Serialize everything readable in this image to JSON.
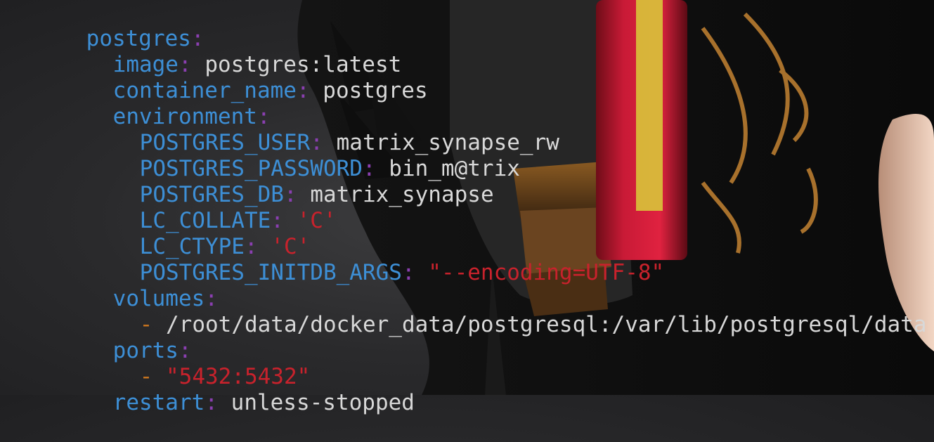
{
  "colors": {
    "key": "#3d8fd6",
    "colon": "#8a3fb0",
    "plain_value": "#d8d8d8",
    "string_value": "#c8222c",
    "list_dash": "#c6741f"
  },
  "yaml": {
    "service_key": "postgres",
    "image_key": "image",
    "image_value": "postgres:latest",
    "container_name_key": "container_name",
    "container_name_value": "postgres",
    "environment_key": "environment",
    "env": {
      "user_key": "POSTGRES_USER",
      "user_value": "matrix_synapse_rw",
      "password_key": "POSTGRES_PASSWORD",
      "password_value": "bin_m@trix",
      "db_key": "POSTGRES_DB",
      "db_value": "matrix_synapse",
      "collate_key": "LC_COLLATE",
      "collate_value": "'C'",
      "ctype_key": "LC_CTYPE",
      "ctype_value": "'C'",
      "initdb_key": "POSTGRES_INITDB_ARGS",
      "initdb_value": "\"--encoding=UTF-8\""
    },
    "volumes_key": "volumes",
    "volumes_item": "/root/data/docker_data/postgresql:/var/lib/postgresql/data",
    "ports_key": "ports",
    "ports_item": "\"5432:5432\"",
    "restart_key": "restart",
    "restart_value": "unless-stopped",
    "colon": ":",
    "dash": "-"
  }
}
